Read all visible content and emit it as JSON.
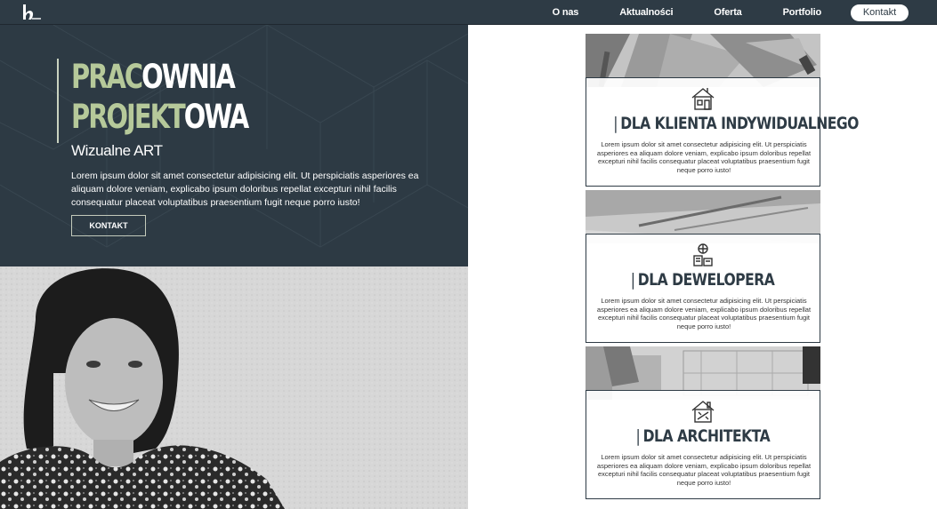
{
  "nav": {
    "logo_icon": "brand-logo-icon",
    "links": [
      "O nas",
      "Aktualności",
      "Oferta",
      "Portfolio"
    ],
    "contact_label": "Kontakt"
  },
  "hero": {
    "title_line1_accent": "PRAC",
    "title_line1_rest": "OWNIA",
    "title_line2_accent": "PROJEKT",
    "title_line2_rest": "OWA",
    "subtitle": "Wizualne ART",
    "text": "Lorem ipsum dolor sit amet consectetur adipisicing elit. Ut perspiciatis asperiores ea aliquam dolore veniam, explicabo ipsum doloribus repellat excepturi nihil facilis consequatur placeat voluptatibus praesentium fugit neque porro iusto!",
    "button_label": "KONTAKT"
  },
  "cards": [
    {
      "icon": "house-plan-icon",
      "pipe": "|",
      "title": "DLA KLIENTA INDYWIDUALNEGO",
      "text": "Lorem ipsum dolor sit amet consectetur adipisicing elit. Ut perspiciatis asperiores ea aliquam dolore veniam, explicabo ipsum doloribus repellat excepturi nihil facilis consequatur placeat voluptatibus praesentium fugit neque porro iusto!"
    },
    {
      "icon": "developer-tools-icon",
      "pipe": "|",
      "title": "DLA DEWELOPERA",
      "text": "Lorem ipsum dolor sit amet consectetur adipisicing elit. Ut perspiciatis asperiores ea aliquam dolore veniam, explicabo ipsum doloribus repellat excepturi nihil facilis consequatur placeat voluptatibus praesentium fugit neque porro iusto!"
    },
    {
      "icon": "architect-house-icon",
      "pipe": "|",
      "title": "DLA ARCHITEKTA",
      "text": "Lorem ipsum dolor sit amet consectetur adipisicing elit. Ut perspiciatis asperiores ea aliquam dolore veniam, explicabo ipsum doloribus repellat excepturi nihil facilis consequatur placeat voluptatibus praesentium fugit neque porro iusto!"
    }
  ],
  "colors": {
    "nav_bg": "#2e3b45",
    "hero_bg": "#2d3a44",
    "accent_green": "#b6c99a",
    "text_white": "#ffffff"
  }
}
